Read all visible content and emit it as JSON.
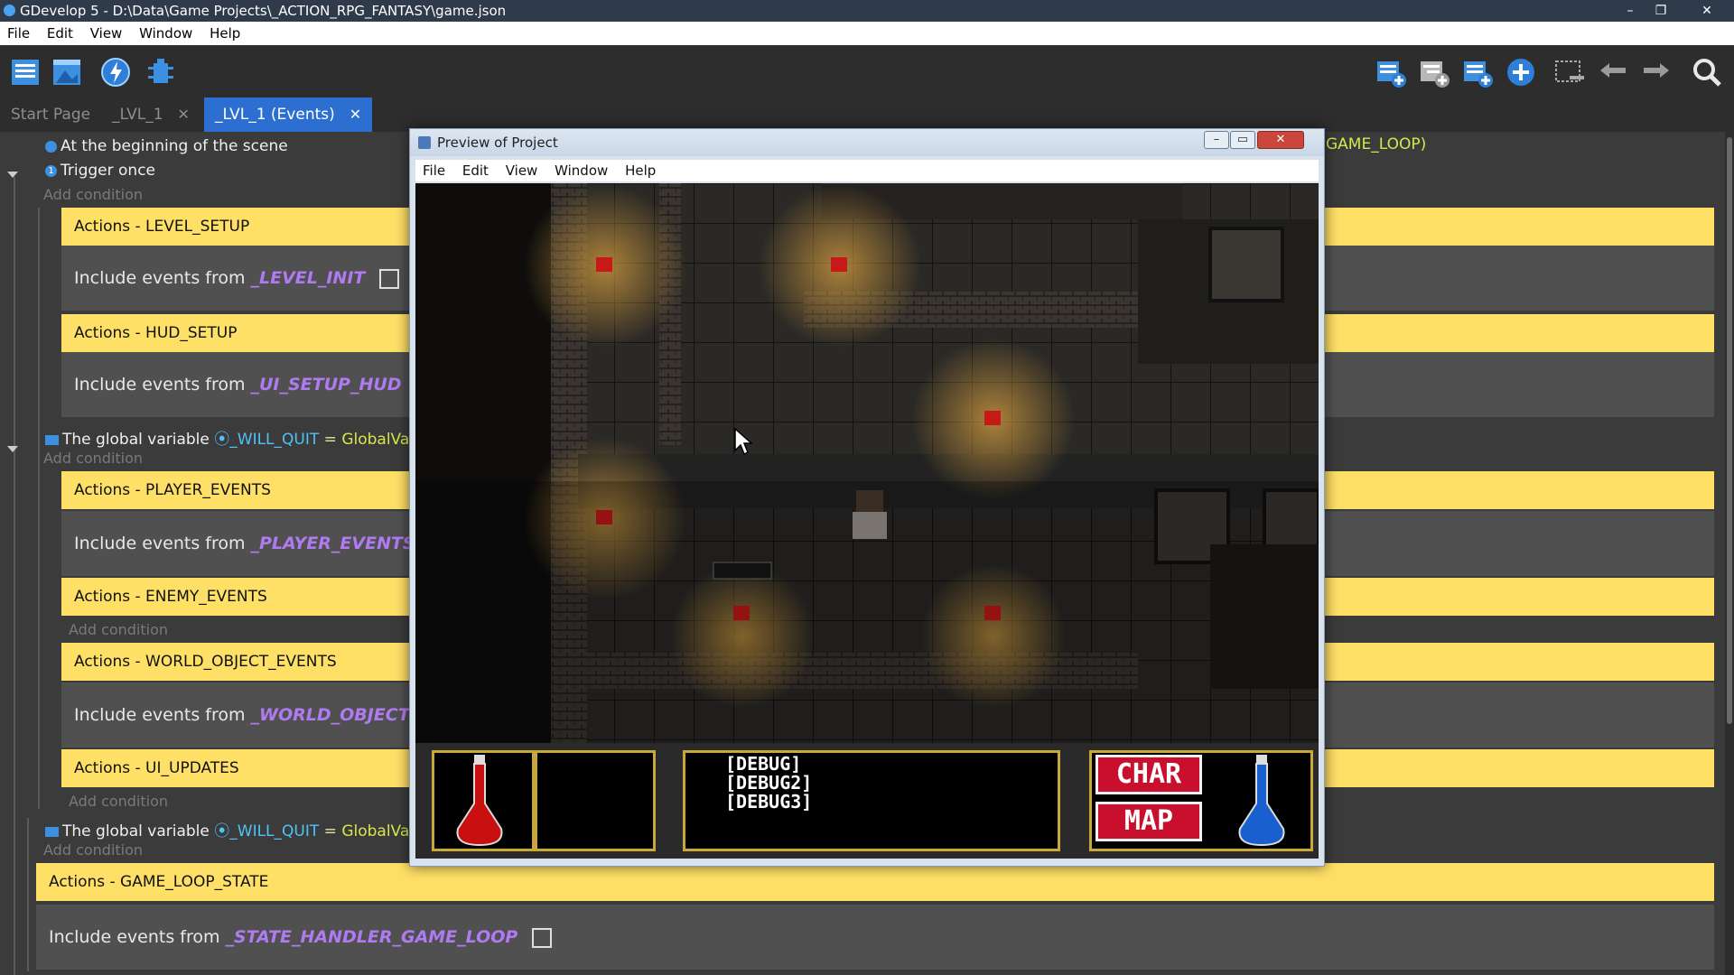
{
  "window": {
    "title": "GDevelop 5 - D:\\Data\\Game Projects\\_ACTION_RPG_FANTASY\\game.json",
    "controls": [
      "–",
      "❐",
      "✕"
    ]
  },
  "menubar": [
    "File",
    "Edit",
    "View",
    "Window",
    "Help"
  ],
  "toolbar": {
    "left_icons": [
      "project-manager-icon",
      "scene-editor-icon",
      "events-icon",
      "debugger-icon"
    ],
    "right_icons": [
      "add-event-icon",
      "add-subevent-icon",
      "add-comment-icon",
      "add-more-icon",
      "delete-icon",
      "undo-icon",
      "redo-icon",
      "search-icon"
    ]
  },
  "tabs": [
    {
      "label": "Start Page",
      "closable": false,
      "active": false
    },
    {
      "label": "_LVL_1",
      "closable": true,
      "active": false
    },
    {
      "label": "_LVL_1 (Events)",
      "closable": true,
      "active": true
    }
  ],
  "events": {
    "cond_begin": "At the beginning of the scene",
    "cond_trigger": "Trigger once",
    "add_condition": "Add condition",
    "include_prefix": "Include events from",
    "actions": {
      "level_setup": "Actions - LEVEL_SETUP",
      "hud_setup": "Actions - HUD_SETUP",
      "player_events": "Actions - PLAYER_EVENTS",
      "enemy_events": "Actions - ENEMY_EVENTS",
      "world_object_events": "Actions - WORLD_OBJECT_EVENTS",
      "ui_updates": "Actions - UI_UPDATES",
      "game_loop_state": "Actions - GAME_LOOP_STATE"
    },
    "includes": {
      "level_init": "_LEVEL_INIT",
      "ui_setup_hud": "_UI_SETUP_HUD",
      "player_events": "_PLAYER_EVENTS",
      "world_object": "_WORLD_OBJECT_EV",
      "state_handler": "_STATE_HANDLER_GAME_LOOP"
    },
    "global_var": {
      "prefix": "The global variable",
      "name": "_WILL_QUIT",
      "op": "=",
      "value": "GlobalVaria"
    },
    "hidden_right_text": "GAME_LOOP)"
  },
  "preview": {
    "title": "Preview of Project",
    "menu": [
      "File",
      "Edit",
      "View",
      "Window",
      "Help"
    ],
    "debug_lines": [
      "[DEBUG]",
      "[DEBUG2]",
      "[DEBUG3]"
    ],
    "buttons": {
      "char": "CHAR",
      "map": "MAP"
    }
  },
  "colors": {
    "action_bg": "#ffe066",
    "include_link": "#b07af0",
    "tab_active": "#2d6fd1",
    "variable": "#4fc3f7"
  }
}
